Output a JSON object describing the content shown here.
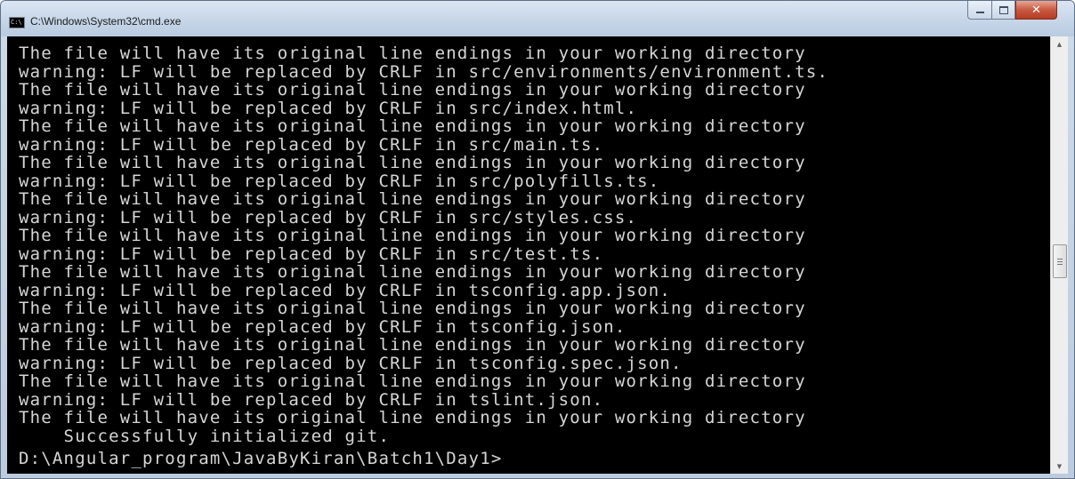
{
  "window": {
    "title": "C:\\Windows\\System32\\cmd.exe",
    "app_icon": "cmd-icon",
    "icon_text": "C:\\",
    "buttons": {
      "minimize": "minimize-icon",
      "maximize": "maximize-icon",
      "close": "✕"
    }
  },
  "console": {
    "lines": [
      "The file will have its original line endings in your working directory",
      "warning: LF will be replaced by CRLF in src/environments/environment.ts.",
      "The file will have its original line endings in your working directory",
      "warning: LF will be replaced by CRLF in src/index.html.",
      "The file will have its original line endings in your working directory",
      "warning: LF will be replaced by CRLF in src/main.ts.",
      "The file will have its original line endings in your working directory",
      "warning: LF will be replaced by CRLF in src/polyfills.ts.",
      "The file will have its original line endings in your working directory",
      "warning: LF will be replaced by CRLF in src/styles.css.",
      "The file will have its original line endings in your working directory",
      "warning: LF will be replaced by CRLF in src/test.ts.",
      "The file will have its original line endings in your working directory",
      "warning: LF will be replaced by CRLF in tsconfig.app.json.",
      "The file will have its original line endings in your working directory",
      "warning: LF will be replaced by CRLF in tsconfig.json.",
      "The file will have its original line endings in your working directory",
      "warning: LF will be replaced by CRLF in tsconfig.spec.json.",
      "The file will have its original line endings in your working directory",
      "warning: LF will be replaced by CRLF in tslint.json.",
      "The file will have its original line endings in your working directory",
      "    Successfully initialized git."
    ],
    "prompt": "D:\\Angular_program\\JavaByKiran\\Batch1\\Day1>"
  },
  "scrollbar": {
    "up_arrow": "▲",
    "down_arrow": "▼",
    "position": 0.5
  },
  "colors": {
    "console_bg": "#000000",
    "console_text": "#d6d6d6",
    "close_button": "#c85a43",
    "titlebar": "#c7d6e8"
  }
}
